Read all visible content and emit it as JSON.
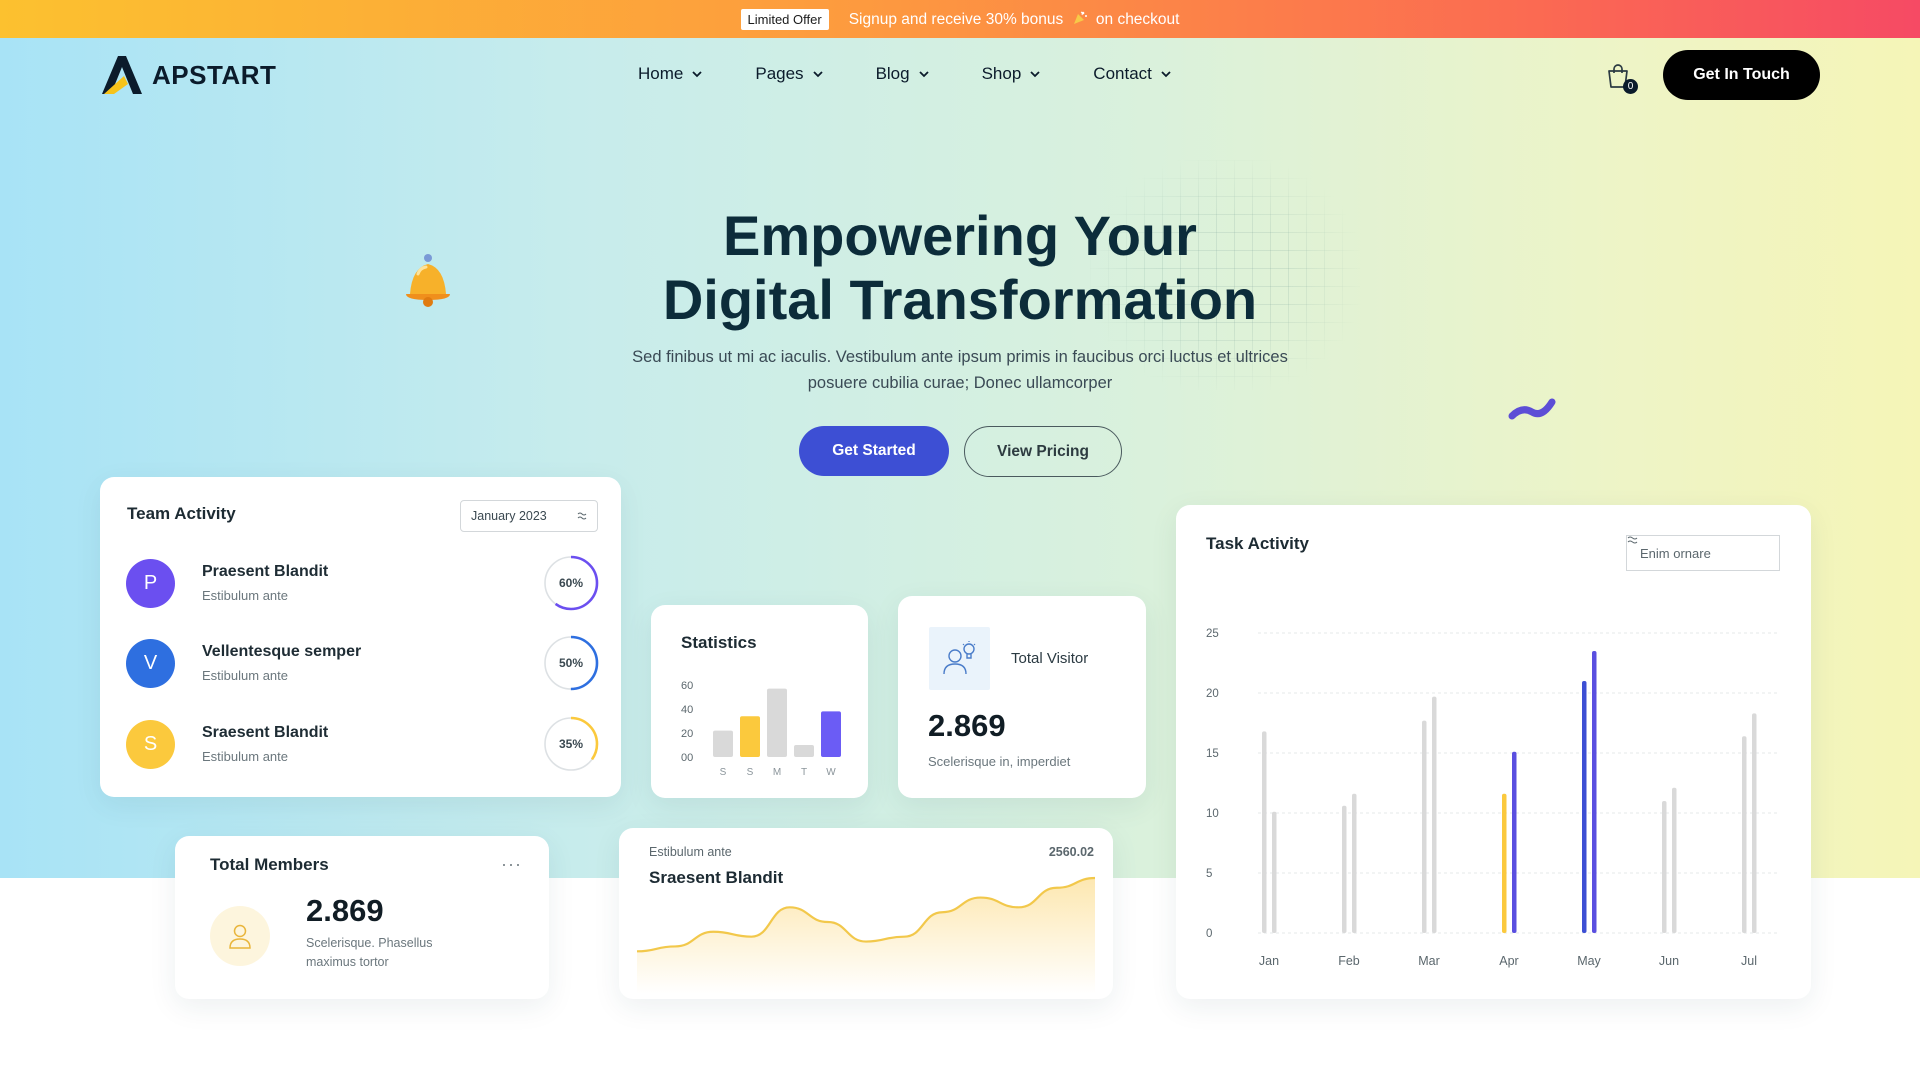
{
  "announcement": {
    "badge": "Limited Offer",
    "message_before": "Signup and receive 30% bonus",
    "message_after": "on checkout"
  },
  "brand": {
    "name": "APSTART"
  },
  "nav": {
    "items": [
      {
        "label": "Home"
      },
      {
        "label": "Pages"
      },
      {
        "label": "Blog"
      },
      {
        "label": "Shop"
      },
      {
        "label": "Contact"
      }
    ],
    "cart_count": "0",
    "cta": "Get In Touch"
  },
  "hero": {
    "title_line1": "Empowering Your",
    "title_line2": "Digital Transformation",
    "subtitle": "Sed finibus ut mi ac iaculis. Vestibulum ante ipsum primis in faucibus orci luctus et ultrices posuere cubilia curae; Donec ullamcorper",
    "primary_button": "Get Started",
    "secondary_button": "View Pricing"
  },
  "team_activity": {
    "title": "Team Activity",
    "month_select": "January 2023",
    "members": [
      {
        "initial": "P",
        "name": "Praesent Blandit",
        "role": "Estibulum ante",
        "percent_label": "60%",
        "percent": 60,
        "color": "#6b4ff0"
      },
      {
        "initial": "V",
        "name": "Vellentesque semper",
        "role": "Estibulum ante",
        "percent_label": "50%",
        "percent": 50,
        "color": "#2e6fe0"
      },
      {
        "initial": "S",
        "name": "Sraesent Blandit",
        "role": "Estibulum ante",
        "percent_label": "35%",
        "percent": 35,
        "color": "#fbc93d"
      }
    ]
  },
  "statistics": {
    "title": "Statistics"
  },
  "total_visitor": {
    "label": "Total Visitor",
    "value": "2.869",
    "description": "Scelerisque in, imperdiet"
  },
  "task_activity": {
    "title": "Task Activity",
    "select": "Enim ornare"
  },
  "total_members": {
    "title": "Total Members",
    "menu": "···",
    "value": "2.869",
    "description": "Scelerisque. Phasellus maximus tortor"
  },
  "area_card": {
    "eyebrow": "Estibulum ante",
    "amount": "2560.02",
    "title": "Sraesent Blandit"
  },
  "colors": {
    "primary": "#3d4fd4",
    "accent_yellow": "#fbc93d",
    "accent_purple": "#6b4ff0",
    "neutral_bar": "#d9d9d9"
  },
  "chart_data": [
    {
      "type": "bar",
      "title": "Statistics",
      "categories": [
        "S",
        "S",
        "M",
        "T",
        "W"
      ],
      "values": [
        22,
        34,
        57,
        10,
        38
      ],
      "highlight_colors": [
        "#d9d9d9",
        "#fbc93d",
        "#d9d9d9",
        "#d9d9d9",
        "#6b5cf5"
      ],
      "ytick_labels": [
        "00",
        "20",
        "40",
        "60"
      ],
      "ylim": [
        0,
        60
      ]
    },
    {
      "type": "bar",
      "title": "Task Activity",
      "categories": [
        "Jan",
        "Feb",
        "Mar",
        "Apr",
        "May",
        "Jun",
        "Jul"
      ],
      "series": [
        {
          "values": [
            16.8,
            10.6,
            17.7,
            11.6,
            21.0,
            11.0,
            16.4
          ]
        },
        {
          "values": [
            10.1,
            11.6,
            19.7,
            15.1,
            23.5,
            12.1,
            18.3
          ]
        }
      ],
      "highlight": {
        "Apr": [
          "#fbc93d",
          "#5a4fe0"
        ],
        "May": [
          "#3d4fd4",
          "#5a4fe0"
        ]
      },
      "yticks": [
        0,
        5,
        10,
        15,
        20,
        25
      ],
      "ylim": [
        0,
        25
      ],
      "grid": true
    },
    {
      "type": "area",
      "title": "Sraesent Blandit",
      "values": [
        3,
        4,
        7,
        6,
        12,
        9,
        5,
        6,
        11,
        14,
        12,
        16,
        18
      ]
    }
  ]
}
